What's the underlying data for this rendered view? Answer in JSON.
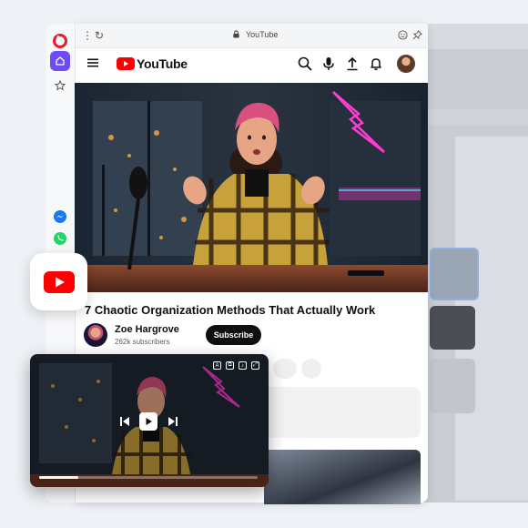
{
  "browser": {
    "address": "YouTube",
    "icons": [
      "menu-dots-icon",
      "reload-icon",
      "lock-icon",
      "emoji-icon",
      "pin-icon"
    ]
  },
  "sidebar": {
    "items": [
      "opera-logo",
      "home-icon",
      "star-icon",
      "messenger-icon",
      "whatsapp-icon"
    ]
  },
  "youtube": {
    "logo_text": "YouTube",
    "header_icons": [
      "menu-icon",
      "search-icon",
      "mic-icon",
      "upload-icon",
      "bell-icon"
    ],
    "video": {
      "title": "7 Chaotic Organization Methods That Actually Work",
      "channel_name": "Zoe Hargrove",
      "subscribers": "262k subscribers",
      "subscribe_label": "Subscribe"
    }
  },
  "mini_player": {
    "progress": 0.18,
    "controls": [
      "previous-icon",
      "play-icon",
      "next-icon"
    ]
  },
  "colors": {
    "youtube_red": "#ff0000",
    "opera_red": "#e81b2a",
    "opera_purple": "#6e4bf6",
    "messenger_blue": "#1877f2",
    "whatsapp_green": "#25d366",
    "neon_pink": "#ff3cd2"
  }
}
